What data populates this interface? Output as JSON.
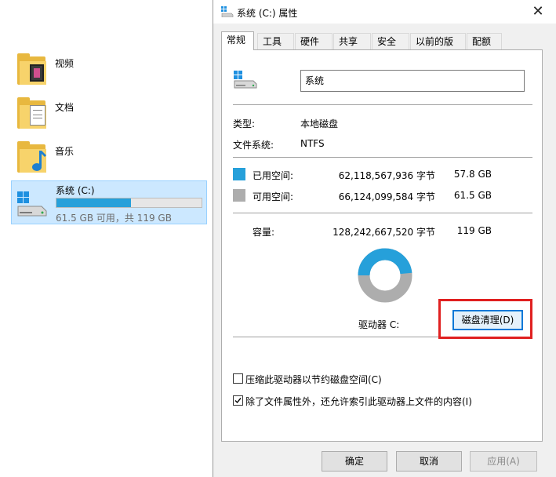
{
  "explorer": {
    "folders": [
      {
        "label": "视频",
        "icon": "video-folder-icon"
      },
      {
        "label": "文档",
        "icon": "documents-folder-icon"
      },
      {
        "label": "音乐",
        "icon": "music-folder-icon"
      }
    ],
    "drive": {
      "name": "系统 (C:)",
      "subtitle": "61.5 GB 可用，共 119 GB",
      "used_fraction": 0.516
    }
  },
  "dialog": {
    "title": "系统 (C:) 属性",
    "tabs": [
      "常规",
      "工具",
      "硬件",
      "共享",
      "安全",
      "以前的版本",
      "配额"
    ],
    "active_tab": "常规",
    "name_value": "系统",
    "type_label": "类型:",
    "type_value": "本地磁盘",
    "fs_label": "文件系统:",
    "fs_value": "NTFS",
    "used_label": "已用空间:",
    "used_bytes": "62,118,567,936 字节",
    "used_gb": "57.8 GB",
    "free_label": "可用空间:",
    "free_bytes": "66,124,099,584 字节",
    "free_gb": "61.5 GB",
    "capacity_label": "容量:",
    "capacity_bytes": "128,242,667,520 字节",
    "capacity_gb": "119 GB",
    "drive_label": "驱动器 C:",
    "cleanup_button": "磁盘清理(D)",
    "compress_label": "压缩此驱动器以节约磁盘空间(C)",
    "compress_checked": false,
    "index_label": "除了文件属性外，还允许索引此驱动器上文件的内容(I)",
    "index_checked": true,
    "ok_button": "确定",
    "cancel_button": "取消",
    "apply_button": "应用(A)",
    "used_fraction": 0.484
  },
  "colors": {
    "used": "#26a0da",
    "free": "#adadad",
    "highlight": "#e02020"
  }
}
